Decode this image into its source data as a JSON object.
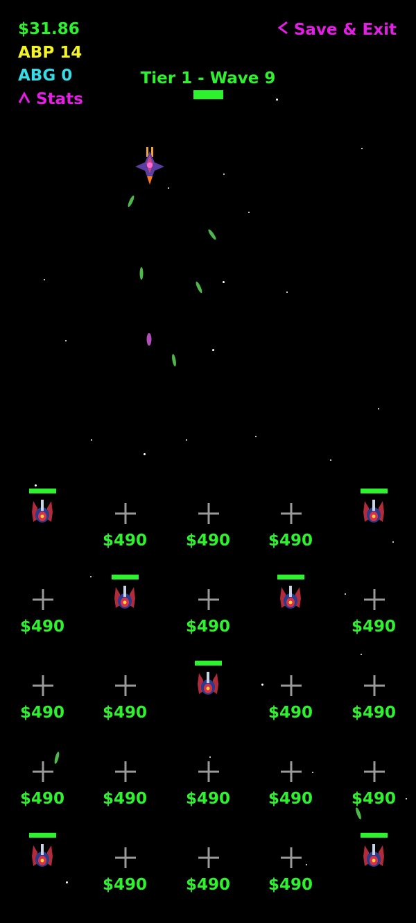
{
  "hud": {
    "money": "$31.86",
    "abp": "ABP 14",
    "abg": "ABG 0",
    "stats_label": "Stats",
    "stats_icon": "chevron-up-icon",
    "exit_label": "Save & Exit",
    "exit_icon": "chevron-left-icon"
  },
  "wave": {
    "title": "Tier 1 - Wave 9",
    "health_fraction": 1.0
  },
  "colors": {
    "money": "#2ef22e",
    "abp": "#f4f425",
    "abg": "#35dbe6",
    "menu": "#e41ee4",
    "price": "#2ef22e",
    "health": "#2ef22e"
  },
  "grid": {
    "rows": [
      [
        "turret",
        "$490",
        "$490",
        "$490",
        "turret"
      ],
      [
        "$490",
        "turret",
        "$490",
        "turret",
        "$490"
      ],
      [
        "$490",
        "$490",
        "turret",
        "$490",
        "$490"
      ],
      [
        "$490",
        "$490",
        "$490",
        "$490",
        "$490"
      ],
      [
        "turret",
        "$490",
        "$490",
        "$490",
        "turret"
      ]
    ]
  },
  "enemy": {
    "icon": "enemy-ship-icon"
  },
  "projectiles": {
    "icon": "laser-bolt-icon"
  }
}
